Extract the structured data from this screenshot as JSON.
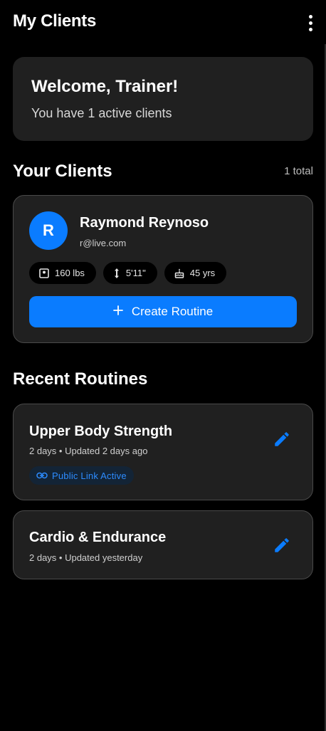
{
  "header": {
    "title": "My Clients",
    "menu_icon": "more-vert-icon"
  },
  "welcome": {
    "title": "Welcome, Trainer!",
    "subtitle": "You have 1 active clients"
  },
  "clients_section": {
    "title": "Your Clients",
    "count": "1 total"
  },
  "client": {
    "initial": "R",
    "name": "Raymond Reynoso",
    "email": "r@live.com",
    "weight": "160 lbs",
    "height": "5'11\"",
    "age": "45 yrs",
    "create_button": "Create Routine"
  },
  "routines_section": {
    "title": "Recent Routines"
  },
  "routines": [
    {
      "title": "Upper Body Strength",
      "meta": "2 days • Updated 2 days ago",
      "badge": "Public Link Active"
    },
    {
      "title": "Cardio & Endurance",
      "meta": "2 days • Updated yesterday"
    }
  ],
  "colors": {
    "accent": "#0a7cff",
    "card": "#202020",
    "background": "#000000",
    "badge_text": "#2d8cff"
  }
}
